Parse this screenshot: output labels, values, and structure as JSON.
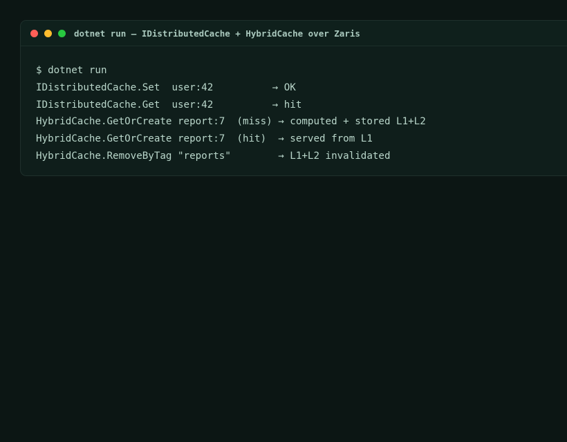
{
  "window": {
    "title": "dotnet run — IDistributedCache + HybridCache over Zaris",
    "controls": {
      "close_color": "#ff5f57",
      "minimize_color": "#febc2e",
      "maximize_color": "#28c840"
    }
  },
  "terminal": {
    "lines": [
      "$ dotnet run",
      "IDistributedCache.Set  user:42          → OK",
      "IDistributedCache.Get  user:42          → hit",
      "HybridCache.GetOrCreate report:7  (miss) → computed + stored L1+L2",
      "HybridCache.GetOrCreate report:7  (hit)  → served from L1",
      "HybridCache.RemoveByTag \"reports\"        → L1+L2 invalidated"
    ]
  }
}
